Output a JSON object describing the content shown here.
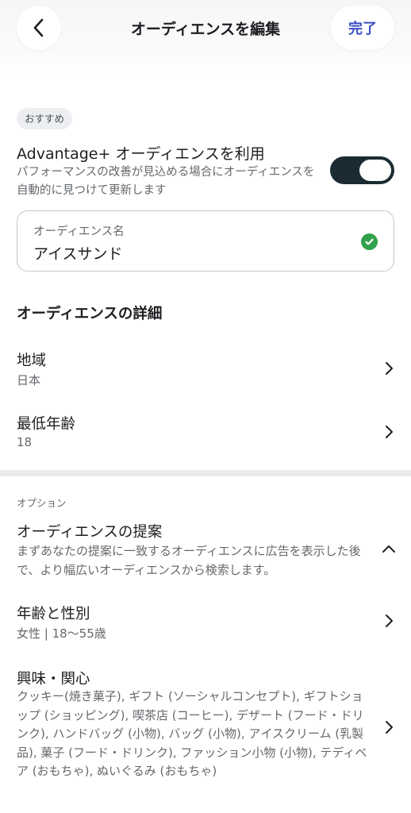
{
  "header": {
    "title": "オーディエンスを編集",
    "done_label": "完了"
  },
  "recommend_badge": "おすすめ",
  "advantage": {
    "title": "Advantage+ オーディエンスを利用",
    "description": "パフォーマンスの改善が見込める場合にオーディエンスを自動的に見つけて更新します",
    "enabled": true
  },
  "audience_name": {
    "label": "オーディエンス名",
    "value": "アイスサンド"
  },
  "details": {
    "section_title": "オーディエンスの詳細",
    "region": {
      "title": "地域",
      "value": "日本"
    },
    "min_age": {
      "title": "最低年齢",
      "value": "18"
    }
  },
  "options": {
    "label": "オプション",
    "suggestions": {
      "title": "オーディエンスの提案",
      "description": "まずあなたの提案に一致するオーディエンスに広告を表示した後で、より幅広いオーディエンスから検索します。"
    },
    "age_gender": {
      "title": "年齢と性別",
      "value": "女性 | 18～55歳"
    },
    "interests": {
      "title": "興味・関心",
      "value": "クッキー(焼き菓子), ギフト (ソーシャルコンセプト), ギフトショップ (ショッピング), 喫茶店 (コーヒー), デザート (フード・ドリンク), ハンドバッグ (小物), バッグ (小物), アイスクリーム (乳製品), 菓子 (フード・ドリンク), ファッション小物 (小物), テディベア (おもちゃ), ぬいぐるみ (おもちゃ)"
    }
  },
  "icons": [
    "back-chevron-icon",
    "check-circle-icon",
    "chevron-right-icon",
    "chevron-up-icon"
  ],
  "colors": {
    "accent": "#3b4fc4",
    "toggle_on": "#1c2b33",
    "check": "#31a24c"
  }
}
